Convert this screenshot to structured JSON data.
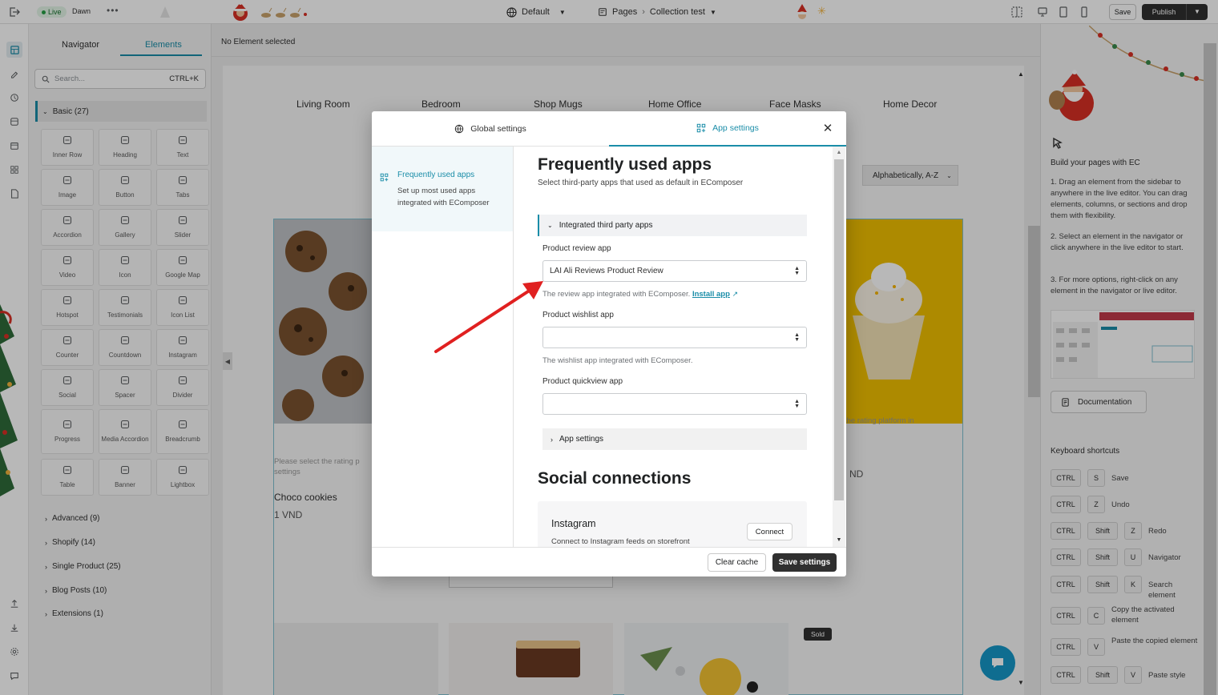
{
  "topbar": {
    "live_label": "Live",
    "theme_name": "Dawn",
    "more_icon": "ellipsis-icon",
    "device_selector": "Default",
    "pages_label": "Pages",
    "page_name": "Collection test",
    "save_label": "Save",
    "publish_label": "Publish"
  },
  "left_panel": {
    "tabs": [
      "Navigator",
      "Elements"
    ],
    "active_tab": "Elements",
    "search_placeholder": "Search...",
    "search_shortcut": "CTRL+K",
    "basic_category": "Basic (27)",
    "elements": [
      {
        "label": "Inner Row",
        "icon": "inner-row-icon"
      },
      {
        "label": "Heading",
        "icon": "heading-icon"
      },
      {
        "label": "Text",
        "icon": "text-icon"
      },
      {
        "label": "Image",
        "icon": "image-icon"
      },
      {
        "label": "Button",
        "icon": "button-icon"
      },
      {
        "label": "Tabs",
        "icon": "tabs-icon"
      },
      {
        "label": "Accordion",
        "icon": "accordion-icon"
      },
      {
        "label": "Gallery",
        "icon": "gallery-icon"
      },
      {
        "label": "Slider",
        "icon": "slider-icon"
      },
      {
        "label": "Video",
        "icon": "video-icon"
      },
      {
        "label": "Icon",
        "icon": "icon-icon"
      },
      {
        "label": "Google Map",
        "icon": "map-icon"
      },
      {
        "label": "Hotspot",
        "icon": "hotspot-icon"
      },
      {
        "label": "Testimonials",
        "icon": "testimonials-icon"
      },
      {
        "label": "Icon List",
        "icon": "icon-list-icon"
      },
      {
        "label": "Counter",
        "icon": "counter-icon"
      },
      {
        "label": "Countdown",
        "icon": "countdown-icon"
      },
      {
        "label": "Instagram",
        "icon": "instagram-icon"
      },
      {
        "label": "Social",
        "icon": "social-icon"
      },
      {
        "label": "Spacer",
        "icon": "spacer-icon"
      },
      {
        "label": "Divider",
        "icon": "divider-icon"
      },
      {
        "label": "Progress",
        "icon": "progress-icon"
      },
      {
        "label": "Media Accordion",
        "icon": "media-accordion-icon"
      },
      {
        "label": "Breadcrumb",
        "icon": "breadcrumb-icon"
      },
      {
        "label": "Table",
        "icon": "table-icon"
      },
      {
        "label": "Banner",
        "icon": "banner-icon"
      },
      {
        "label": "Lightbox",
        "icon": "lightbox-icon"
      }
    ],
    "categories": [
      "Advanced (9)",
      "Shopify (14)",
      "Single Product (25)",
      "Blog Posts (10)",
      "Extensions (1)"
    ]
  },
  "canvas": {
    "status": "No Element selected",
    "menu": [
      "Living Room",
      "Bedroom",
      "Shop Mugs",
      "Home Office",
      "Face Masks",
      "Home Decor"
    ],
    "sort_label": "Alphabetically, A-Z",
    "product_title": "Choco cookies",
    "product_price": "1 VND",
    "rating_notice_left": "Please select the rating p",
    "rating_notice_left2": "settings",
    "rating_notice_right": "the rating platform in",
    "price_right": "ND",
    "sold_badge": "Sold"
  },
  "right_panel": {
    "title": "Build your pages with EC",
    "steps": [
      "1. Drag an element from the sidebar to anywhere in the live editor. You can drag elements, columns, or sections and drop them with flexibility.",
      "2. Select an element in the navigator or click anywhere in the live editor to start.",
      "3. For more options, right-click on any element in the navigator or live editor."
    ],
    "doc_button": "Documentation",
    "shortcuts_title": "Keyboard shortcuts",
    "shortcuts": [
      {
        "keys": [
          "CTRL",
          "S"
        ],
        "label": "Save"
      },
      {
        "keys": [
          "CTRL",
          "Z"
        ],
        "label": "Undo"
      },
      {
        "keys": [
          "CTRL",
          "Shift",
          "Z"
        ],
        "label": "Redo"
      },
      {
        "keys": [
          "CTRL",
          "Shift",
          "U"
        ],
        "label": "Navigator"
      },
      {
        "keys": [
          "CTRL",
          "Shift",
          "K"
        ],
        "label": "Search element"
      },
      {
        "keys": [
          "CTRL",
          "C"
        ],
        "label": "Copy the activated element"
      },
      {
        "keys": [
          "CTRL",
          "V"
        ],
        "label": "Paste the copied element"
      },
      {
        "keys": [
          "CTRL",
          "Shift",
          "V"
        ],
        "label": "Paste style"
      }
    ]
  },
  "modal": {
    "tab_global": "Global settings",
    "tab_app": "App settings",
    "sidebar_title": "Frequently used apps",
    "sidebar_desc": "Set up most used apps integrated with EComposer",
    "heading": "Frequently used apps",
    "subheading": "Select third-party apps that used as default in EComposer",
    "accordion_integrated": "Integrated third party apps",
    "review_label": "Product review app",
    "review_value": "LAI Ali Reviews Product Review",
    "review_help": "The review app integrated with EComposer.",
    "install_link": "Install app",
    "wishlist_label": "Product wishlist app",
    "wishlist_value": "",
    "wishlist_help": "The wishlist app integrated with EComposer.",
    "quickview_label": "Product quickview app",
    "quickview_value": "",
    "accordion_app_settings": "App settings",
    "social_heading": "Social connections",
    "instagram_title": "Instagram",
    "instagram_desc": "Connect to Instagram feeds on storefront",
    "connect_label": "Connect",
    "clear_cache": "Clear cache",
    "save_settings": "Save settings"
  },
  "colors": {
    "accent": "#1a8da8",
    "annotation_arrow": "#e02020",
    "dark_button": "#303030"
  }
}
